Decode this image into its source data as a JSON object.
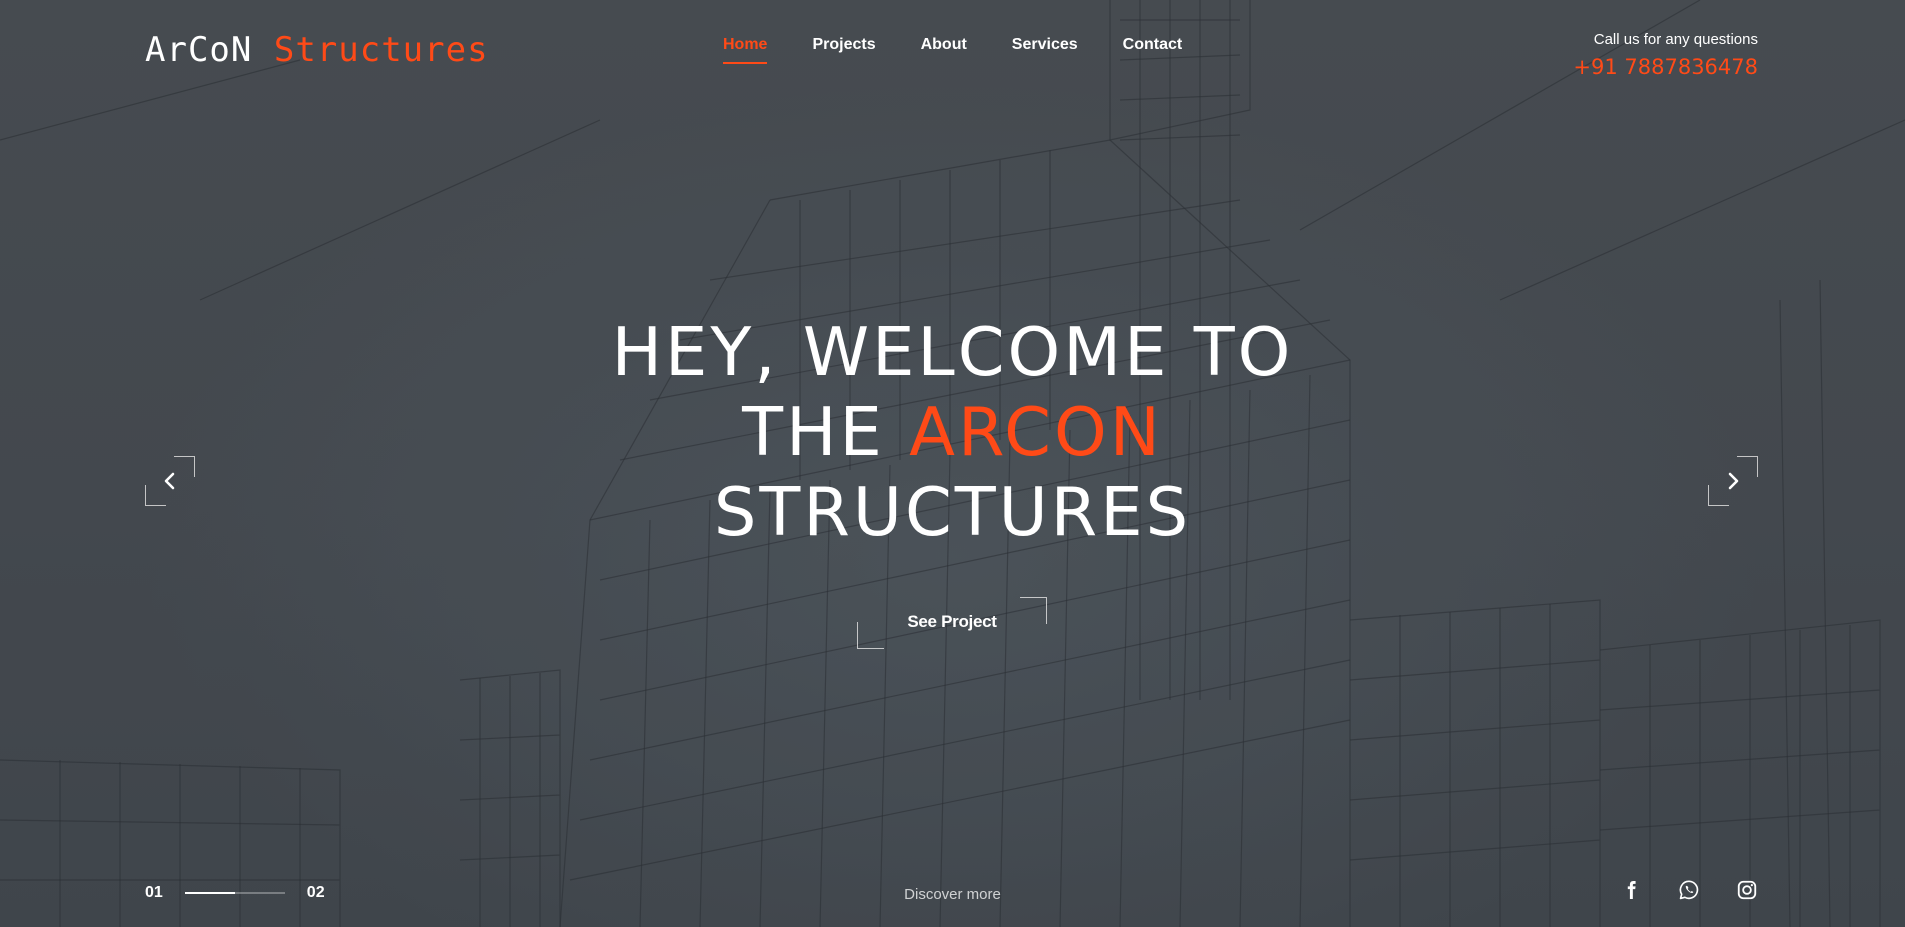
{
  "logo": {
    "part1": "ArCoN",
    "part2": "Structures"
  },
  "nav": {
    "items": [
      {
        "label": "Home",
        "active": true
      },
      {
        "label": "Projects"
      },
      {
        "label": "About"
      },
      {
        "label": "Services"
      },
      {
        "label": "Contact"
      }
    ]
  },
  "contact": {
    "label": "Call us for any questions",
    "phone": "+91 7887836478"
  },
  "hero": {
    "line1": "HEY, WELCOME TO",
    "line2_prefix": "THE",
    "line2_accent": "ARCON",
    "line3": "STRUCTURES",
    "cta_label": "See Project"
  },
  "slider": {
    "current": "01",
    "total": "02",
    "progress": 0.5,
    "prev_icon": "chevron-left-icon",
    "next_icon": "chevron-right-icon"
  },
  "discover_label": "Discover more",
  "socials": [
    {
      "icon": "facebook-icon"
    },
    {
      "icon": "whatsapp-icon"
    },
    {
      "icon": "instagram-icon"
    }
  ],
  "colors": {
    "accent": "#ff4a17",
    "text": "#ffffff",
    "background": "#4a4f54"
  }
}
